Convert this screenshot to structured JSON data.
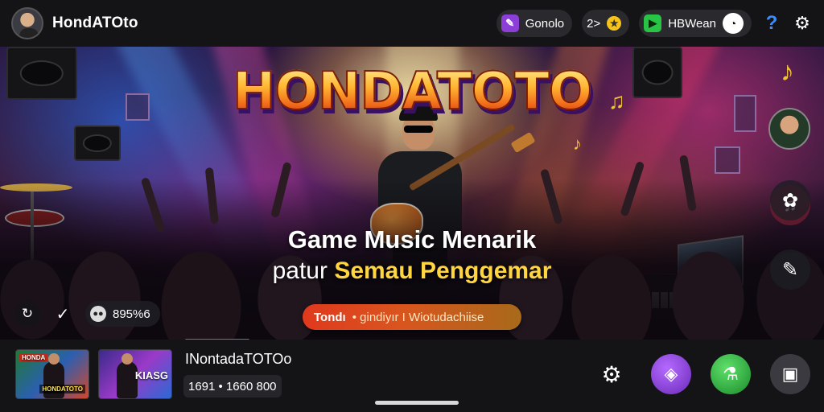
{
  "header": {
    "app_title": "HondATOto",
    "pill1_label": "Gonolo",
    "pill1_icon": "sparkle-icon",
    "coins_label": "2>",
    "pill2_label": "HBWean",
    "pill2_icon": "play-icon",
    "help_icon": "help-icon",
    "settings_icon": "gear-icon"
  },
  "hero": {
    "logo_text": "HONDATOTO",
    "headline": "Game Music Menarik",
    "subline_part1": "patur",
    "subline_part2": "Semau Penggemar",
    "tag_label": "Tondı",
    "tag_text": "• gindiyır I Wiotudachiise",
    "views_label": "895%6",
    "side_buttons": [
      "music-icon",
      "badge-icon",
      "edit-icon"
    ]
  },
  "player": {
    "track_title": "INontadaTOTOo",
    "track_meta": "1691 • 1660 800",
    "thumb1_badge": "HONDA",
    "thumb1_caption": "HONDATOTO",
    "thumb2_caption": "KIASG"
  },
  "colors": {
    "accent_blue": "#2f7bff",
    "accent_gold": "#ffd640",
    "tag_orange": "#e0391d",
    "bar_bg": "#141416"
  }
}
